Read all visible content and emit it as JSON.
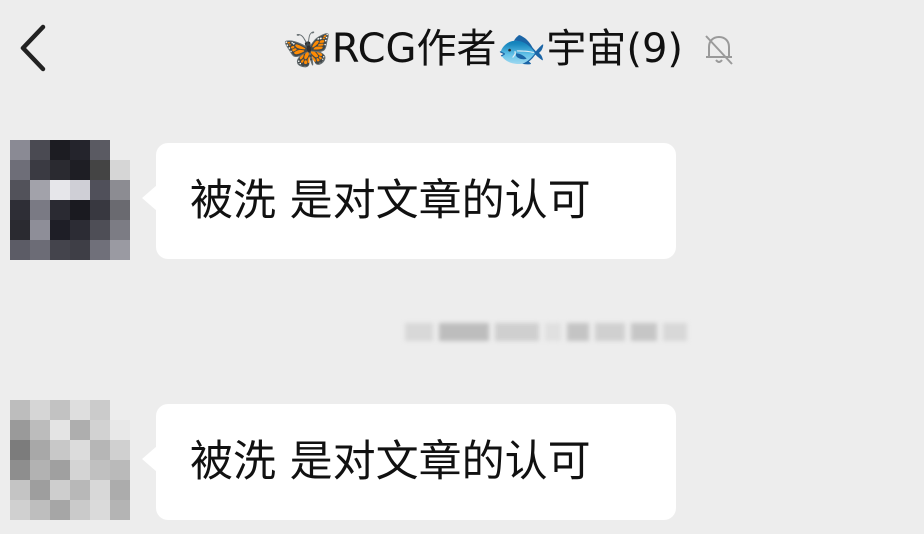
{
  "header": {
    "back_icon": "chevron-left-icon",
    "title": "🦋RCG作者🐟宇宙(9)",
    "mute_icon": "bell-off-icon"
  },
  "messages": [
    {
      "text": "被洗 是对文章的认可",
      "avatar": "pixelated-avatar"
    },
    {
      "text": "被洗 是对文章的认可",
      "avatar": "pixelated-avatar"
    }
  ],
  "timestamp": {
    "redacted": true
  },
  "colors": {
    "background": "#ededed",
    "bubble": "#ffffff",
    "text": "#111111",
    "icon": "#222222"
  }
}
